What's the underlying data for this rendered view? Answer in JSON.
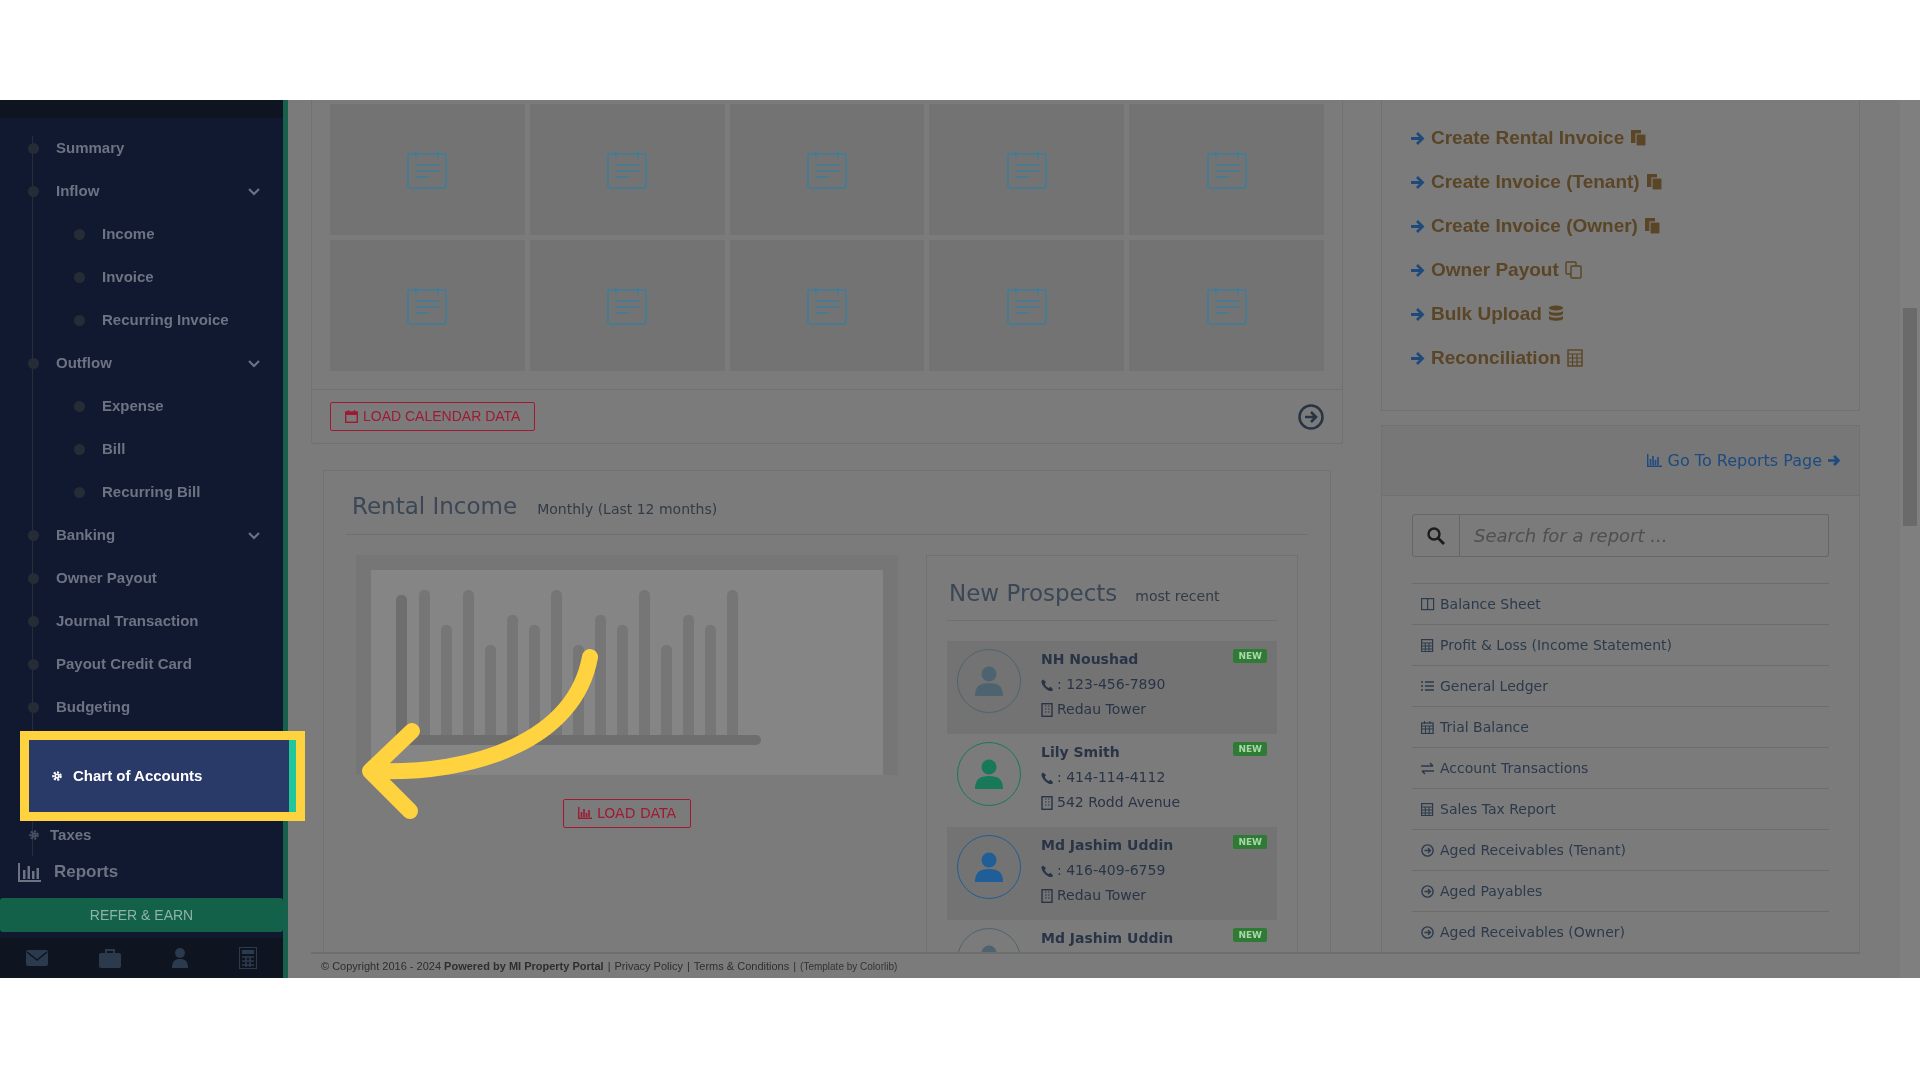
{
  "sidebar": {
    "items": [
      {
        "label": "Summary",
        "kind": "link",
        "selected": false
      },
      {
        "label": "Inflow",
        "kind": "group",
        "selected": false,
        "children": [
          {
            "label": "Income",
            "selected": false
          },
          {
            "label": "Invoice",
            "selected": false
          },
          {
            "label": "Recurring Invoice",
            "selected": false
          }
        ]
      },
      {
        "label": "Outflow",
        "kind": "group",
        "selected": false,
        "children": [
          {
            "label": "Expense",
            "selected": false
          },
          {
            "label": "Bill",
            "selected": false
          },
          {
            "label": "Recurring Bill",
            "selected": false
          }
        ]
      },
      {
        "label": "Banking",
        "kind": "group",
        "selected": false
      },
      {
        "label": "Owner Payout",
        "kind": "link",
        "selected": false
      },
      {
        "label": "Journal Transaction",
        "kind": "link",
        "selected": false
      },
      {
        "label": "Payout Credit Card",
        "kind": "link",
        "selected": false
      },
      {
        "label": "Budgeting",
        "kind": "link",
        "selected": false
      },
      {
        "label": "Chart of Accounts",
        "kind": "setting",
        "selected": true
      },
      {
        "label": "Taxes",
        "kind": "setting",
        "selected": false
      }
    ],
    "reports": "Reports",
    "refer_button": "REFER & EARN"
  },
  "calendar": {
    "load_button": "LOAD CALENDAR DATA"
  },
  "rental_income": {
    "title": "Rental Income",
    "subtitle": "Monthly (Last 12 months)",
    "load_button": "LOAD DATA"
  },
  "prospects": {
    "title": "New Prospects",
    "subtitle": "most recent",
    "items": [
      {
        "name": "NH Noushad",
        "badge": "NEW",
        "phone": ": 123-456-7890",
        "address": "Redau Tower",
        "color": "#4d6470"
      },
      {
        "name": "Lily Smith",
        "badge": "NEW",
        "phone": ": 414-114-4112",
        "address": "542 Rodd Avenue",
        "color": "#17795a"
      },
      {
        "name": "Md Jashim Uddin",
        "badge": "NEW",
        "phone": ": 416-409-6759",
        "address": "Redau Tower",
        "color": "#1f5e96"
      },
      {
        "name": "Md Jashim Uddin",
        "badge": "NEW",
        "color": "#4d6470"
      }
    ]
  },
  "quick_links": [
    {
      "label": "Create Rental Invoice",
      "kind": "invoice"
    },
    {
      "label": "Create Invoice (Tenant)",
      "kind": "invoice"
    },
    {
      "label": "Create Invoice (Owner)",
      "kind": "invoice"
    },
    {
      "label": "Owner Payout",
      "kind": "copy"
    },
    {
      "label": "Bulk Upload",
      "kind": "database"
    },
    {
      "label": "Reconciliation",
      "kind": "calculator"
    }
  ],
  "reports_panel": {
    "link": "Go To Reports Page",
    "search": {
      "placeholder": "Search for a report ..."
    },
    "items": [
      {
        "label": "Balance Sheet",
        "kind": "columns"
      },
      {
        "label": "Profit & Loss (Income Statement)",
        "kind": "calculator"
      },
      {
        "label": "General Ledger",
        "kind": "list"
      },
      {
        "label": "Trial Balance",
        "kind": "calendar"
      },
      {
        "label": "Account Transactions",
        "kind": "exchange"
      },
      {
        "label": "Sales Tax Report",
        "kind": "calculator"
      },
      {
        "label": "Aged Receivables (Tenant)",
        "kind": "circle"
      },
      {
        "label": "Aged Payables",
        "kind": "circle"
      },
      {
        "label": "Aged Receivables (Owner)",
        "kind": "circle"
      }
    ]
  },
  "footer": {
    "items": [
      {
        "kind": "text",
        "text": "© Copyright 2016 - 2024 **Powered by MI Property Portal**"
      },
      {
        "kind": "separator",
        "text": "|"
      },
      {
        "kind": "link",
        "text": "Privacy Policy"
      },
      {
        "kind": "separator",
        "text": "|"
      },
      {
        "kind": "link",
        "text": "Terms & Conditions"
      },
      {
        "kind": "separator",
        "text": "|"
      },
      {
        "kind": "credit",
        "text": "(Template by Colorlib)"
      }
    ]
  }
}
